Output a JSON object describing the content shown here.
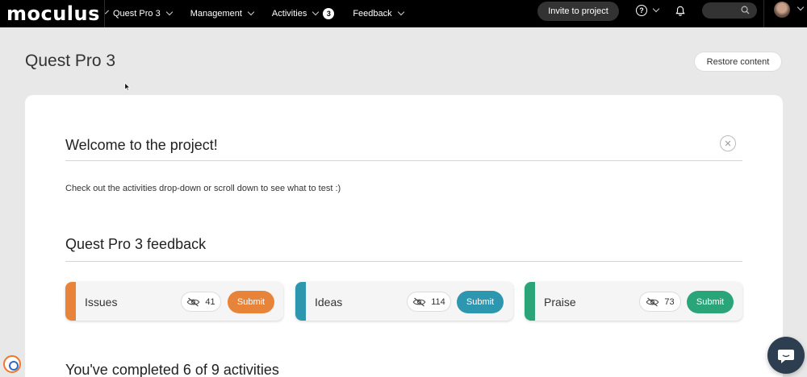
{
  "header": {
    "logo": "moculus",
    "nav": [
      {
        "label": "Quest Pro 3"
      },
      {
        "label": "Management"
      },
      {
        "label": "Activities",
        "badge": "3"
      },
      {
        "label": "Feedback"
      }
    ],
    "invite_label": "Invite to project",
    "help_glyph": "?"
  },
  "page": {
    "title": "Quest Pro 3",
    "restore_label": "Restore content"
  },
  "welcome": {
    "title": "Welcome to the project!",
    "text": "Check out the activities drop-down or scroll down to see what to test :)",
    "close_glyph": "✕"
  },
  "feedback": {
    "title": "Quest Pro 3 feedback",
    "items": [
      {
        "label": "Issues",
        "count": "41",
        "submit": "Submit",
        "color": "#e8833a"
      },
      {
        "label": "Ideas",
        "count": "114",
        "submit": "Submit",
        "color": "#2e97b0"
      },
      {
        "label": "Praise",
        "count": "73",
        "submit": "Submit",
        "color": "#2aa57a"
      }
    ]
  },
  "progress": {
    "text": "You've completed 6 of 9 activities",
    "completed": 6,
    "total": 9
  },
  "icons": {
    "hidden": "eye-slash-icon",
    "search": "search-icon",
    "bell": "bell-icon",
    "chat": "chat-icon"
  }
}
